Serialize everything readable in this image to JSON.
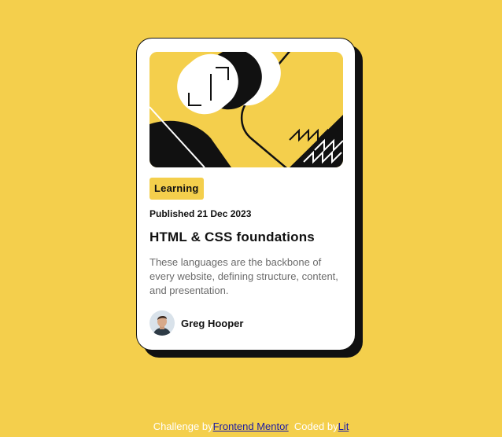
{
  "colors": {
    "background": "#f4cf4c",
    "card": "#ffffff",
    "ink": "#111111",
    "muted_text": "#6b6b6b",
    "link": "#1a1aa6"
  },
  "card": {
    "hero_image": "abstract-illustration",
    "category": "Learning",
    "published": "Published 21 Dec 2023",
    "title": "HTML & CSS foundations",
    "description": "These languages are the backbone of every website, defining structure, content, and presentation.",
    "author": {
      "avatar_icon": "avatar-photo",
      "name": "Greg Hooper"
    }
  },
  "footer": {
    "prefix": "Challenge by",
    "challenge_link": "Frontend Mentor",
    "middle": "Coded by",
    "author_link": "Lit"
  }
}
